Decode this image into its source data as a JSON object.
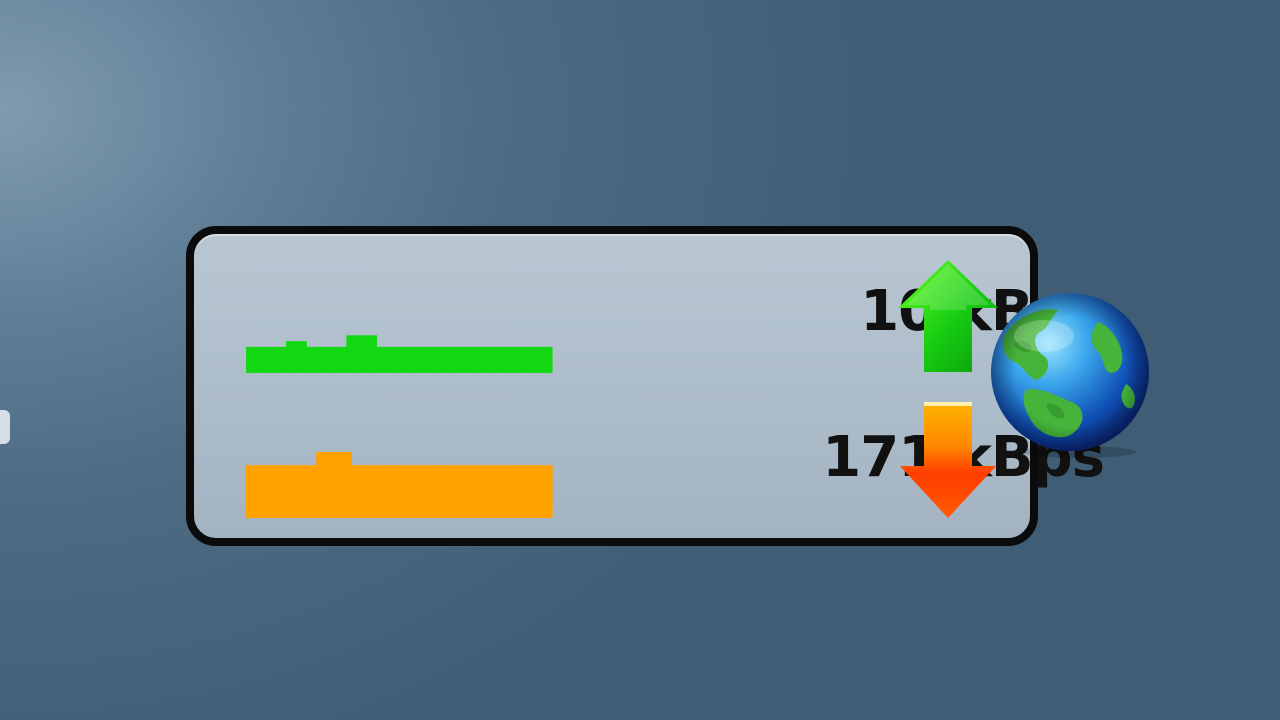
{
  "network_meter": {
    "upload": {
      "rate_text": "10 kBps",
      "graph_color": "#13d813",
      "graph_levels": [
        0.45,
        0.45,
        0.45,
        0.45,
        0.45,
        0.45,
        0.45,
        0.45,
        0.55,
        0.55,
        0.55,
        0.55,
        0.45,
        0.45,
        0.45,
        0.45,
        0.45,
        0.45,
        0.45,
        0.45,
        0.65,
        0.65,
        0.65,
        0.65,
        0.65,
        0.65,
        0.45,
        0.45,
        0.45,
        0.45,
        0.45,
        0.45,
        0.45,
        0.45,
        0.45,
        0.45,
        0.45,
        0.45,
        0.45,
        0.45,
        0.45,
        0.45,
        0.45,
        0.45,
        0.45,
        0.45,
        0.45,
        0.45,
        0.45,
        0.45,
        0.45,
        0.45,
        0.45,
        0.45,
        0.45,
        0.45,
        0.45,
        0.45,
        0.45,
        0.45,
        0.45
      ],
      "arrow_icon": "green-up-arrow-icon"
    },
    "download": {
      "rate_text": "171 kBps",
      "graph_color": "#ffa200",
      "graph_levels": [
        0.8,
        0.8,
        0.8,
        0.8,
        0.8,
        0.8,
        0.8,
        0.8,
        0.8,
        0.8,
        0.8,
        0.8,
        0.8,
        0.8,
        1.0,
        1.0,
        1.0,
        1.0,
        1.0,
        1.0,
        1.0,
        0.8,
        0.8,
        0.8,
        0.8,
        0.8,
        0.8,
        0.8,
        0.8,
        0.8,
        0.8,
        0.8,
        0.8,
        0.8,
        0.8,
        0.8,
        0.8,
        0.8,
        0.8,
        0.8,
        0.8,
        0.8,
        0.8,
        0.8,
        0.8,
        0.8,
        0.8,
        0.8,
        0.8,
        0.8,
        0.8,
        0.8,
        0.8,
        0.8,
        0.8,
        0.8,
        0.8,
        0.8,
        0.8,
        0.8,
        0.8
      ],
      "arrow_icon": "orange-down-arrow-icon"
    },
    "globe_icon": "globe-icon"
  }
}
